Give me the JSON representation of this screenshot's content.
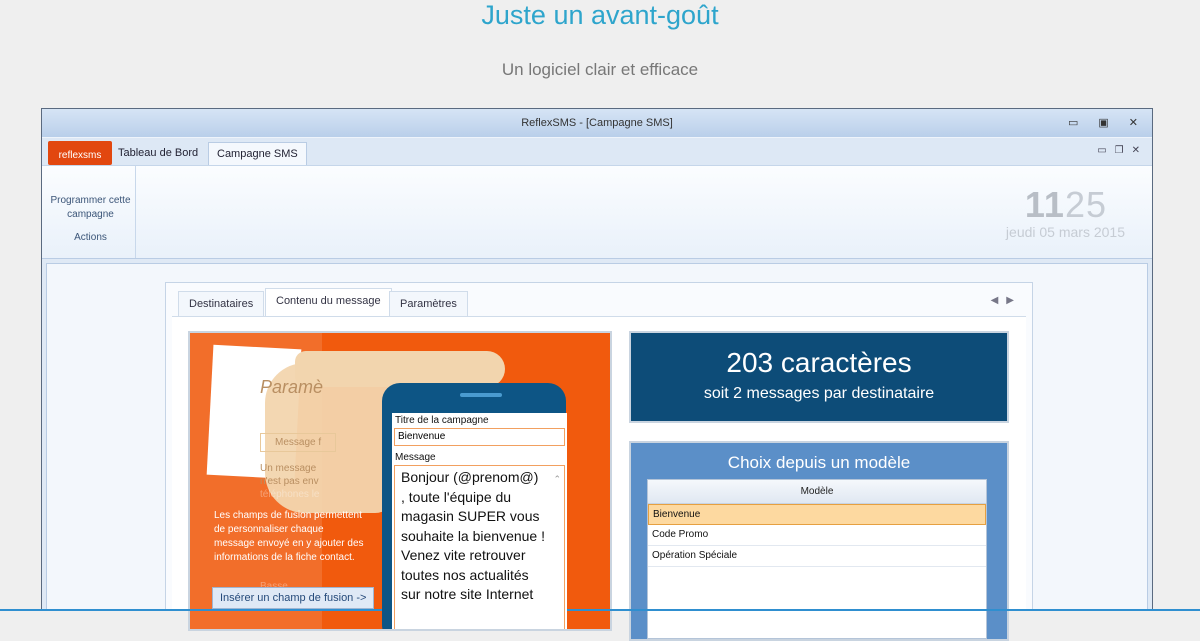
{
  "hero": {
    "title": "Juste un avant-goût",
    "subtitle": "Un logiciel clair et efficace"
  },
  "window": {
    "title": "ReflexSMS - [Campagne SMS]",
    "controls": [
      "▭",
      "▣",
      "✕"
    ],
    "mdi_controls": [
      "▭",
      "❐",
      "✕"
    ]
  },
  "logo": "reflexsms",
  "ribbon_tabs": [
    "Tableau de Bord",
    "Campagne SMS"
  ],
  "ribbon": {
    "button": "Programmer cette campagne",
    "group": "Actions",
    "time_hours": "11",
    "time_minutes": "25",
    "date": "jeudi 05 mars 2015"
  },
  "tabs": [
    "Destinataires",
    "Contenu du message",
    "Paramètres"
  ],
  "illustration": {
    "ghost": [
      "Paramè",
      "Message f",
      "Un message",
      "n'est pas env",
      "téléphones le",
      "Basse"
    ],
    "info": "Les champs de fusion permettent de personnaliser chaque message envoyé en y ajouter des informations de la fiche contact.",
    "insert_button": "Insérer un champ de fusion ->"
  },
  "form": {
    "title_label": "Titre de la campagne",
    "title_value": "Bienvenue",
    "message_label": "Message",
    "message_value": "Bonjour (@prenom@) , toute l'équipe du magasin SUPER vous souhaite la bienvenue ! Venez vite retrouver toutes nos actualités sur notre site Internet"
  },
  "counter": {
    "chars": "203 caractères",
    "messages": "soit 2 messages par destinataire"
  },
  "model": {
    "title": "Choix depuis un modèle",
    "column": "Modèle",
    "rows": [
      "Bienvenue",
      "Code Promo",
      "Opération Spéciale"
    ]
  }
}
